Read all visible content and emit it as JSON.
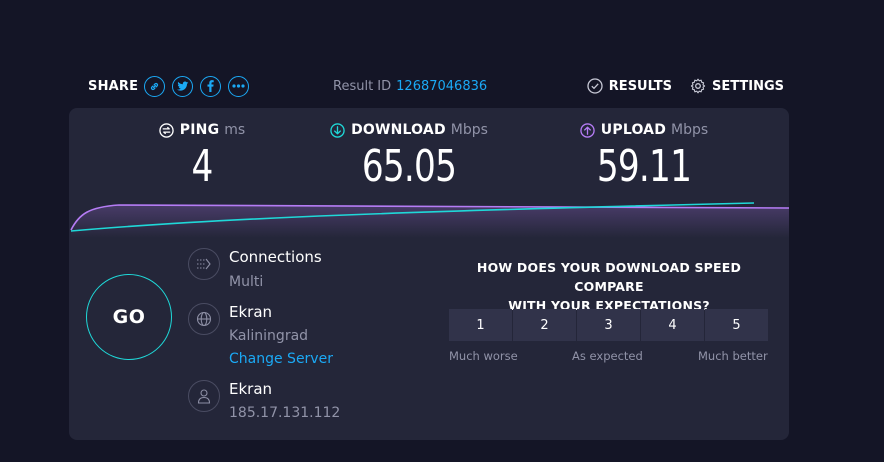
{
  "topbar": {
    "share_label": "SHARE",
    "share_icons": [
      "link-icon",
      "twitter-icon",
      "facebook-icon",
      "more-icon"
    ],
    "result_label": "Result ID",
    "result_id": "12687046836",
    "results_label": "RESULTS",
    "settings_label": "SETTINGS"
  },
  "metrics": {
    "ping": {
      "name": "PING",
      "unit": "ms",
      "value": "4",
      "color": "#ffffff"
    },
    "download": {
      "name": "DOWNLOAD",
      "unit": "Mbps",
      "value": "65.05",
      "color": "#1fd8d8"
    },
    "upload": {
      "name": "UPLOAD",
      "unit": "Mbps",
      "value": "59.11",
      "color": "#b57cf5"
    }
  },
  "go_label": "GO",
  "connections": {
    "title": "Connections",
    "value": "Multi"
  },
  "server": {
    "title": "Ekran",
    "location": "Kaliningrad",
    "change_label": "Change Server"
  },
  "provider": {
    "title": "Ekran",
    "ip": "185.17.131.112"
  },
  "survey": {
    "question_line1": "HOW DOES YOUR DOWNLOAD SPEED COMPARE",
    "question_line2": "WITH YOUR EXPECTATIONS?",
    "options": [
      "1",
      "2",
      "3",
      "4",
      "5"
    ],
    "low_label": "Much worse",
    "mid_label": "As expected",
    "high_label": "Much better"
  },
  "colors": {
    "background": "#141526",
    "panel": "#242639",
    "accent_blue": "#1ba9f5",
    "download_cyan": "#1fd8d8",
    "upload_purple": "#b57cf5",
    "muted_text": "#9193a8"
  }
}
